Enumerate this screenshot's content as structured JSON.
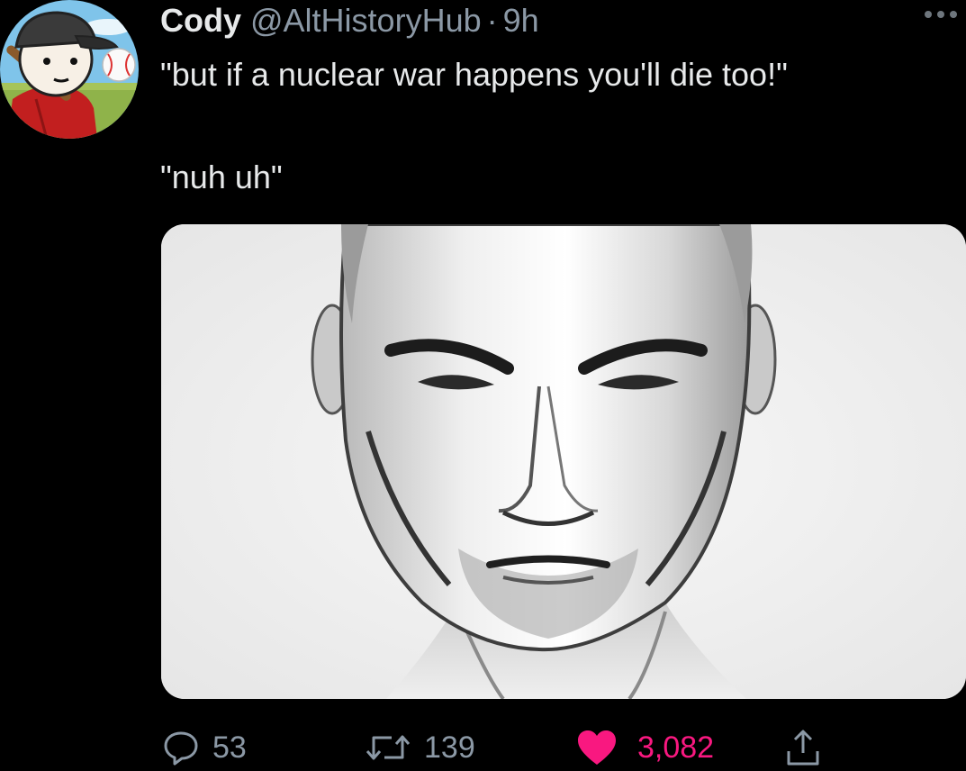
{
  "author": {
    "display_name": "Cody",
    "handle": "@AltHistoryHub",
    "separator": "·",
    "time": "9h",
    "avatar_icon": "cartoon-avatar-icon"
  },
  "tweet": {
    "lines": [
      "\"but if a nuclear war happens you'll die too!\"",
      "\"nuh uh\""
    ],
    "media_description_icon": "grayscale-face-image"
  },
  "actions": {
    "reply": {
      "icon": "reply-icon",
      "count": "53"
    },
    "retweet": {
      "icon": "retweet-icon",
      "count": "139"
    },
    "like": {
      "icon": "heart-icon",
      "count": "3,082",
      "liked": true
    },
    "share": {
      "icon": "share-icon"
    }
  },
  "colors": {
    "background": "#000000",
    "text": "#e7e9ea",
    "secondary": "#8b98a5",
    "like": "#f91880"
  }
}
